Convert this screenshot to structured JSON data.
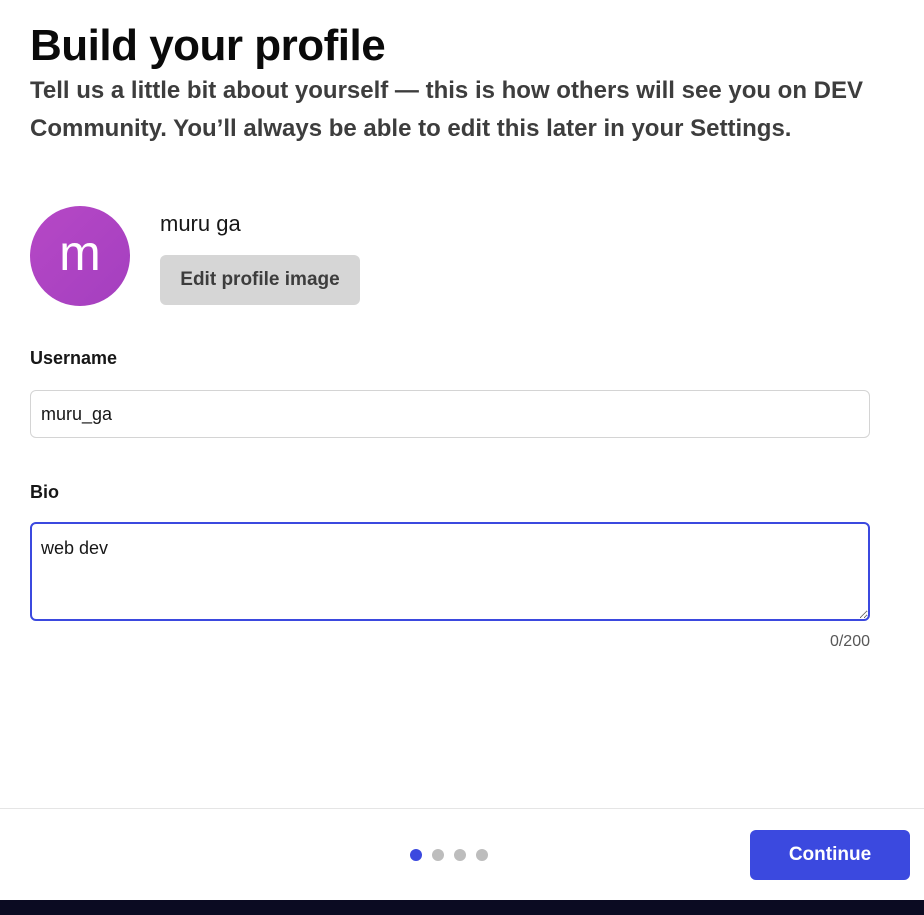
{
  "header": {
    "title": "Build your profile",
    "subtitle": "Tell us a little bit about yourself — this is how others will see you on DEV Community. You’ll always be able to edit this later in your Settings."
  },
  "profile": {
    "avatar_initial": "m",
    "avatar_color": "#b047c4",
    "name": "muru ga",
    "edit_image_label": "Edit profile image"
  },
  "form": {
    "username_label": "Username",
    "username_value": "muru_ga",
    "bio_label": "Bio",
    "bio_value": "web dev",
    "bio_counter": "0/200"
  },
  "footer": {
    "steps_total": 4,
    "current_step": 1,
    "continue_label": "Continue"
  },
  "colors": {
    "accent": "#3b49df",
    "dot_inactive": "#bdbdbd",
    "bottom_bar": "#0b0b22"
  }
}
